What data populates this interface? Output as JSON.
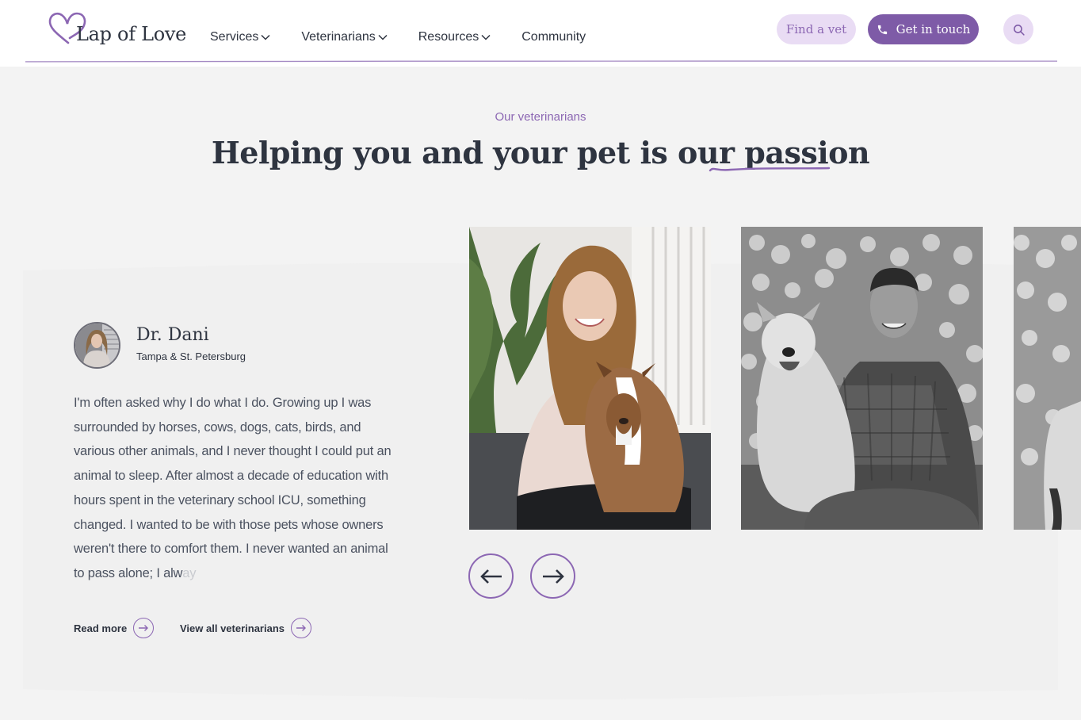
{
  "header": {
    "logo_text": "Lap of Love",
    "nav": [
      {
        "label": "Services",
        "has_dropdown": true
      },
      {
        "label": "Veterinarians",
        "has_dropdown": true
      },
      {
        "label": "Resources",
        "has_dropdown": true
      },
      {
        "label": "Community",
        "has_dropdown": false
      }
    ],
    "find_vet_label": "Find a vet",
    "get_in_touch_label": "Get in touch",
    "search_icon": "search-icon",
    "phone_icon": "phone-icon"
  },
  "section": {
    "eyebrow": "Our veterinarians",
    "headline_main": "Helping you and your pet is our ",
    "headline_accent": "passion"
  },
  "vet": {
    "name": "Dr. Dani",
    "location": "Tampa & St. Petersburg",
    "bio": "I'm often asked why I do what I do. Growing up I was surrounded by horses, cows, dogs, cats, birds, and various other animals, and I never thought I could put an animal to sleep. After almost a decade of education with hours spent in the veterinary school ICU, something changed. I wanted to be with those pets whose owners weren't there to comfort them. I never wanted an animal to pass alone; I alw",
    "bio_faded": "ay",
    "read_more_label": "Read more",
    "view_all_label": "View all veterinarians"
  },
  "carousel": {
    "prev_icon": "arrow-left-icon",
    "next_icon": "arrow-right-icon"
  },
  "colors": {
    "accent": "#8c67b3",
    "accent_dark": "#7e5ba7",
    "accent_light": "#e9dcf4",
    "text": "#2e3440",
    "background": "#f3f3f3"
  }
}
